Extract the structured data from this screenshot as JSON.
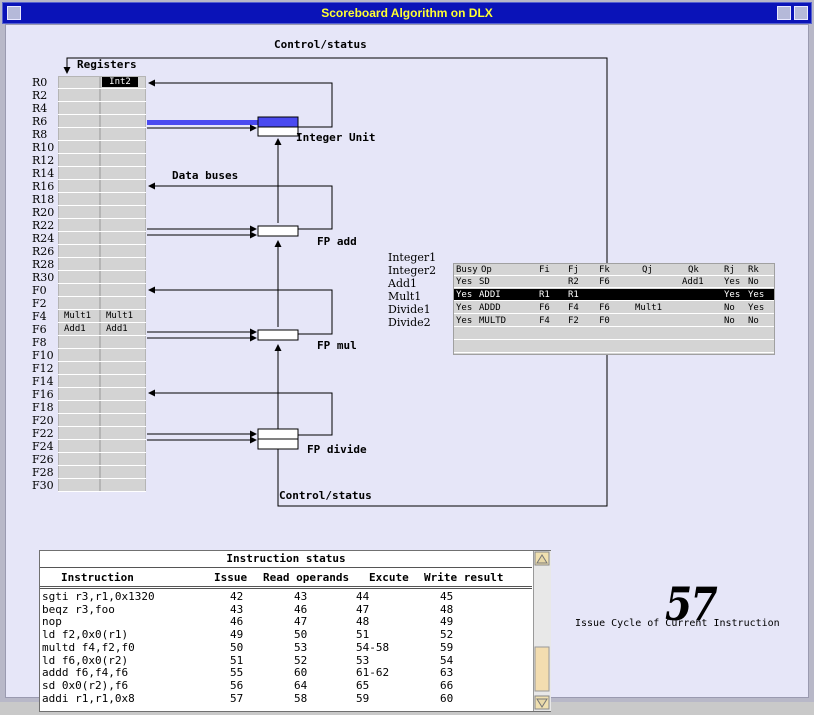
{
  "window": {
    "title": "Scoreboard Algorithm on DLX"
  },
  "labels": {
    "control_status_top": "Control/status",
    "control_status_bottom": "Control/status",
    "registers": "Registers",
    "data_buses": "Data buses",
    "integer_unit": "Integer Unit",
    "fp_add": "FP add",
    "fp_mul": "FP mul",
    "fp_divide": "FP divide"
  },
  "registers": [
    {
      "name": "R0",
      "a": "",
      "b": "Int2"
    },
    {
      "name": "R2",
      "a": "",
      "b": ""
    },
    {
      "name": "R4",
      "a": "",
      "b": ""
    },
    {
      "name": "R6",
      "a": "",
      "b": ""
    },
    {
      "name": "R8",
      "a": "",
      "b": ""
    },
    {
      "name": "R10",
      "a": "",
      "b": ""
    },
    {
      "name": "R12",
      "a": "",
      "b": ""
    },
    {
      "name": "R14",
      "a": "",
      "b": ""
    },
    {
      "name": "R16",
      "a": "",
      "b": ""
    },
    {
      "name": "R18",
      "a": "",
      "b": ""
    },
    {
      "name": "R20",
      "a": "",
      "b": ""
    },
    {
      "name": "R22",
      "a": "",
      "b": ""
    },
    {
      "name": "R24",
      "a": "",
      "b": ""
    },
    {
      "name": "R26",
      "a": "",
      "b": ""
    },
    {
      "name": "R28",
      "a": "",
      "b": ""
    },
    {
      "name": "R30",
      "a": "",
      "b": ""
    },
    {
      "name": "F0",
      "a": "",
      "b": ""
    },
    {
      "name": "F2",
      "a": "",
      "b": ""
    },
    {
      "name": "F4",
      "a": "Mult1",
      "b": "Mult1"
    },
    {
      "name": "F6",
      "a": "Add1",
      "b": "Add1"
    },
    {
      "name": "F8",
      "a": "",
      "b": ""
    },
    {
      "name": "F10",
      "a": "",
      "b": ""
    },
    {
      "name": "F12",
      "a": "",
      "b": ""
    },
    {
      "name": "F14",
      "a": "",
      "b": ""
    },
    {
      "name": "F16",
      "a": "",
      "b": ""
    },
    {
      "name": "F18",
      "a": "",
      "b": ""
    },
    {
      "name": "F20",
      "a": "",
      "b": ""
    },
    {
      "name": "F22",
      "a": "",
      "b": ""
    },
    {
      "name": "F24",
      "a": "",
      "b": ""
    },
    {
      "name": "F26",
      "a": "",
      "b": ""
    },
    {
      "name": "F28",
      "a": "",
      "b": ""
    },
    {
      "name": "F30",
      "a": "",
      "b": ""
    }
  ],
  "fu_status": {
    "headers": [
      "Busy",
      "Op",
      "Fi",
      "Fj",
      "Fk",
      "Qj",
      "Qk",
      "Rj",
      "Rk"
    ],
    "units": [
      {
        "name": "Integer1",
        "busy": "Yes",
        "op": "SD",
        "fi": "",
        "fj": "R2",
        "fk": "F6",
        "qj": "",
        "qk": "Add1",
        "rj": "Yes",
        "rk": "No",
        "selected": false
      },
      {
        "name": "Integer2",
        "busy": "Yes",
        "op": "ADDI",
        "fi": "R1",
        "fj": "R1",
        "fk": "",
        "qj": "",
        "qk": "",
        "rj": "Yes",
        "rk": "Yes",
        "selected": true
      },
      {
        "name": "Add1",
        "busy": "Yes",
        "op": "ADDD",
        "fi": "F6",
        "fj": "F4",
        "fk": "F6",
        "qj": "Mult1",
        "qk": "",
        "rj": "No",
        "rk": "Yes",
        "selected": false
      },
      {
        "name": "Mult1",
        "busy": "Yes",
        "op": "MULTD",
        "fi": "F4",
        "fj": "F2",
        "fk": "F0",
        "qj": "",
        "qk": "",
        "rj": "No",
        "rk": "No",
        "selected": false
      },
      {
        "name": "Divide1",
        "busy": "",
        "op": "",
        "fi": "",
        "fj": "",
        "fk": "",
        "qj": "",
        "qk": "",
        "rj": "",
        "rk": "",
        "selected": false
      },
      {
        "name": "Divide2",
        "busy": "",
        "op": "",
        "fi": "",
        "fj": "",
        "fk": "",
        "qj": "",
        "qk": "",
        "rj": "",
        "rk": "",
        "selected": false
      }
    ]
  },
  "instruction_status": {
    "title": "Instruction status",
    "headers": {
      "instruction": "Instruction",
      "issue": "Issue",
      "read": "Read operands",
      "execute": "Excute",
      "write": "Write result"
    },
    "rows": [
      {
        "instr": "sgti r3,r1,0x1320",
        "issue": "42",
        "read": "43",
        "exec": "44",
        "write": "45"
      },
      {
        "instr": "beqz r3,foo",
        "issue": "43",
        "read": "46",
        "exec": "47",
        "write": "48"
      },
      {
        "instr": "nop",
        "issue": "46",
        "read": "47",
        "exec": "48",
        "write": "49"
      },
      {
        "instr": "ld f2,0x0(r1)",
        "issue": "49",
        "read": "50",
        "exec": "51",
        "write": "52"
      },
      {
        "instr": "multd f4,f2,f0",
        "issue": "50",
        "read": "53",
        "exec": "54-58",
        "write": "59"
      },
      {
        "instr": "ld f6,0x0(r2)",
        "issue": "51",
        "read": "52",
        "exec": "53",
        "write": "54"
      },
      {
        "instr": "addd f6,f4,f6",
        "issue": "55",
        "read": "60",
        "exec": "61-62",
        "write": "63"
      },
      {
        "instr": "sd 0x0(r2),f6",
        "issue": "56",
        "read": "64",
        "exec": "65",
        "write": "66"
      },
      {
        "instr": "addi r1,r1,0x8",
        "issue": "57",
        "read": "58",
        "exec": "59",
        "write": "60"
      }
    ]
  },
  "cycle": {
    "value": "57",
    "caption": "Issue Cycle of Current Instruction"
  },
  "colors": {
    "titlebar": "#0a13b8",
    "title_text": "#ffff33",
    "bus_highlight": "#4a4af0",
    "background": "#e6e6f8"
  }
}
